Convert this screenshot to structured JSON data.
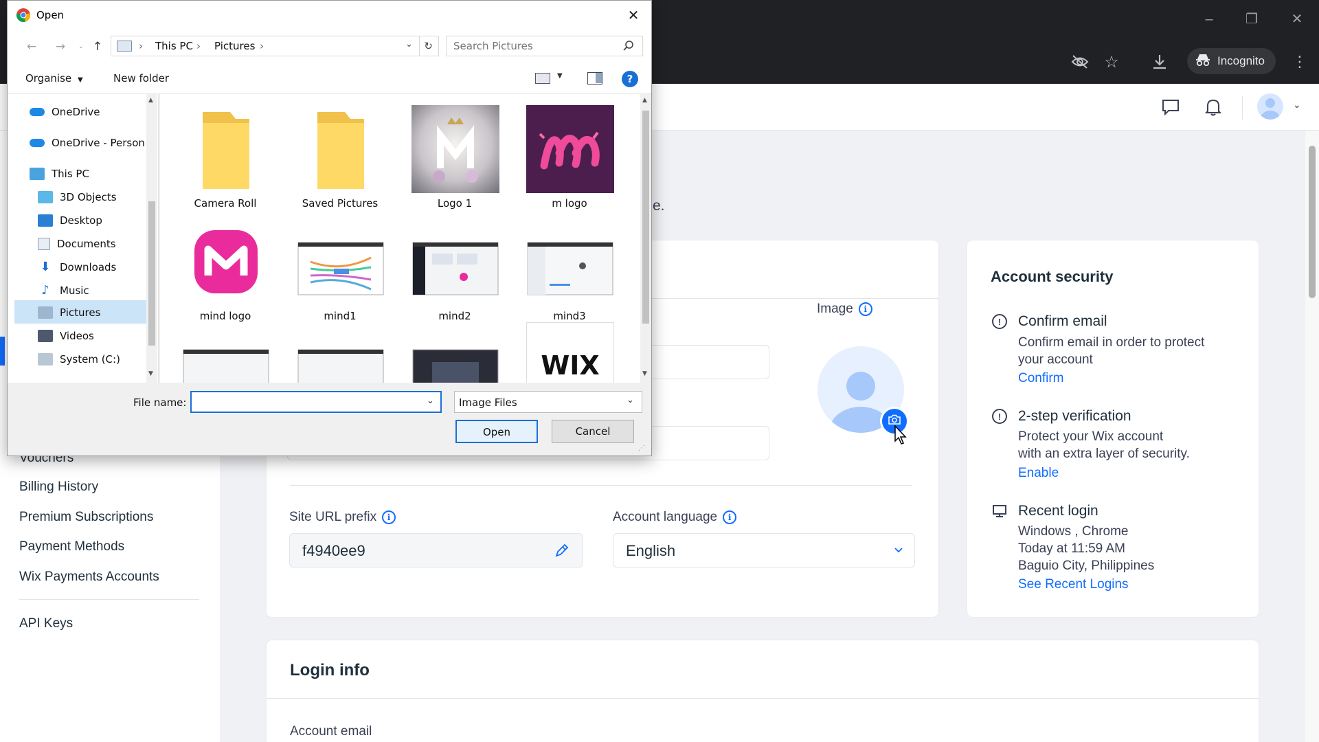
{
  "browser": {
    "incognito_label": "Incognito",
    "window_controls": {
      "minimize": "–",
      "maximize": "❐",
      "close": "✕"
    }
  },
  "left_nav": {
    "items": [
      {
        "label": "Vouchers"
      },
      {
        "label": "Billing History"
      },
      {
        "label": "Premium Subscriptions"
      },
      {
        "label": "Payment Methods"
      },
      {
        "label": "Wix Payments Accounts"
      },
      {
        "label": "API Keys"
      }
    ]
  },
  "profile": {
    "partial_text": "e.",
    "image_label": "Image",
    "site_url_prefix": {
      "label": "Site URL prefix",
      "value": "f4940ee9"
    },
    "account_language": {
      "label": "Account language",
      "value": "English"
    }
  },
  "account_security": {
    "title": "Account security",
    "confirm_email": {
      "title": "Confirm email",
      "line1": "Confirm email in order to protect",
      "line2": "your account",
      "link": "Confirm"
    },
    "two_step": {
      "title": "2-step verification",
      "line1": "Protect your Wix account",
      "line2": "with an extra layer of security.",
      "link": "Enable"
    },
    "recent_login": {
      "title": "Recent login",
      "line1": "Windows , Chrome",
      "line2": "Today at 11:59 AM",
      "line3": "Baguio City, Philippines",
      "link": "See Recent Logins"
    }
  },
  "login_info": {
    "title": "Login info",
    "account_email_label": "Account email"
  },
  "dialog": {
    "title": "Open",
    "breadcrumb": [
      "This PC",
      "Pictures"
    ],
    "search_placeholder": "Search Pictures",
    "organise_label": "Organise",
    "new_folder_label": "New folder",
    "help": "?",
    "tree": [
      {
        "label": "OneDrive"
      },
      {
        "label": "OneDrive - Person"
      },
      {
        "label": "This PC"
      },
      {
        "label": "3D Objects"
      },
      {
        "label": "Desktop"
      },
      {
        "label": "Documents"
      },
      {
        "label": "Downloads"
      },
      {
        "label": "Music"
      },
      {
        "label": "Pictures"
      },
      {
        "label": "Videos"
      },
      {
        "label": "System (C:)"
      }
    ],
    "files": [
      {
        "label": "Camera Roll"
      },
      {
        "label": "Saved Pictures"
      },
      {
        "label": "Logo 1"
      },
      {
        "label": "m logo"
      },
      {
        "label": "mind  logo"
      },
      {
        "label": "mind1"
      },
      {
        "label": "mind2"
      },
      {
        "label": "mind3"
      }
    ],
    "wix_thumb_text": "WIX",
    "file_name_label": "File name:",
    "file_name_value": "",
    "file_type_value": "Image Files",
    "open_label": "Open",
    "cancel_label": "Cancel"
  },
  "colors": {
    "accent": "#116dff",
    "chrome_dark": "#202124",
    "dialog_selection": "#cce4f7"
  }
}
